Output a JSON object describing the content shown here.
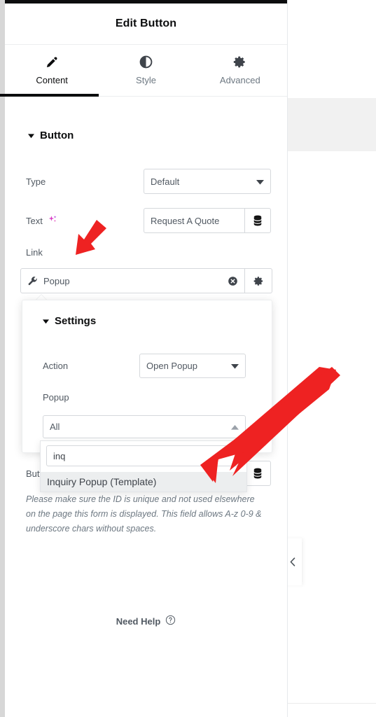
{
  "panel": {
    "title": "Edit Button",
    "tabs": [
      {
        "label": "Content",
        "icon": "pencil-icon",
        "active": true
      },
      {
        "label": "Style",
        "icon": "contrast-half-circle-icon",
        "active": false
      },
      {
        "label": "Advanced",
        "icon": "gear-icon",
        "active": false
      }
    ],
    "sections": {
      "button": {
        "title": "Button",
        "collapse_icon": "caret-down-icon",
        "controls": {
          "type": {
            "label": "Type",
            "value": "Default",
            "dropdown_icon": "caret-down-icon"
          },
          "text": {
            "label": "Text",
            "ai_icon": "ai-sparkle-icon",
            "value": "Request A Quote",
            "dynamic_tag_icon": "dynamic-tags-database-icon"
          },
          "link": {
            "label": "Link",
            "prefix_icon": "wrench-icon",
            "value": "Popup",
            "clear_icon": "clear-circle-x-icon",
            "settings_icon": "gear-icon"
          },
          "button_id": {
            "label": "Butt",
            "value": "",
            "placeholder": "",
            "dynamic_tag_icon": "dynamic-tags-database-icon",
            "description": "Please make sure the ID is unique and not used elsewhere on the page this form is displayed. This field allows A-z  0-9 & underscore chars without spaces."
          }
        }
      }
    },
    "footer": {
      "need_help_label": "Need Help",
      "need_help_icon": "question-circle-icon"
    }
  },
  "settings_popover": {
    "title": "Settings",
    "collapse_icon": "caret-down-icon",
    "action": {
      "label": "Action",
      "value": "Open Popup",
      "dropdown_icon": "caret-down-icon"
    },
    "popup": {
      "label": "Popup",
      "selected_value": "All",
      "dropdown_icon": "caret-up-icon",
      "search_value": "inq",
      "options": [
        {
          "label": "Inquiry Popup (Template)",
          "highlighted": true
        }
      ]
    }
  },
  "canvas": {
    "collapse_handle_icon": "chevron-left-icon"
  },
  "annotations": {
    "arrows": [
      {
        "name": "arrow-pointing-to-link-field",
        "color": "#ee2222"
      },
      {
        "name": "arrow-pointing-to-popup-option",
        "color": "#ee2222"
      }
    ]
  },
  "colors": {
    "accent_dark": "#0c0d0e",
    "label_text": "#515962",
    "muted_text": "#6d7882",
    "border": "#d5d8dc",
    "panel_divider": "#eceeef",
    "arrow_red": "#ee2222",
    "ai_pink": "#e642c8",
    "highlight_row": "#eceeef"
  }
}
